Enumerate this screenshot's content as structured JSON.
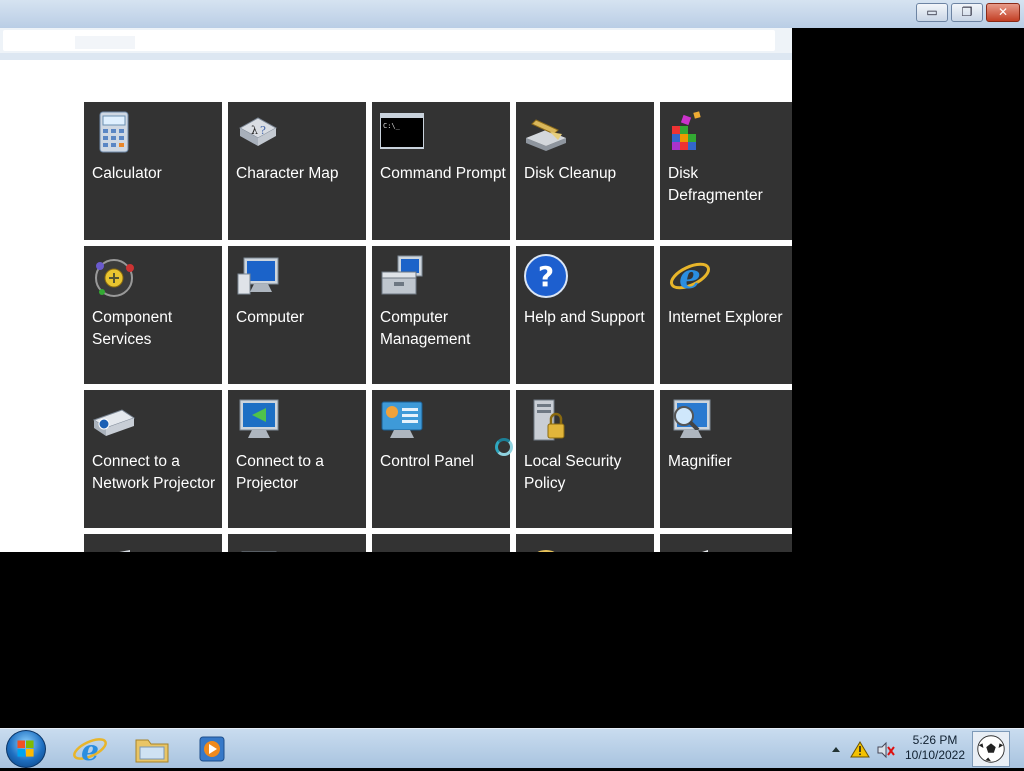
{
  "window": {
    "min_symbol": "▭",
    "max_symbol": "❐",
    "close_symbol": "✕"
  },
  "tiles": [
    {
      "label": "Calculator",
      "icon": "calculator-icon"
    },
    {
      "label": "Character Map",
      "icon": "character-map-icon"
    },
    {
      "label": "Command Prompt",
      "icon": "command-prompt-icon"
    },
    {
      "label": "Disk Cleanup",
      "icon": "disk-cleanup-icon"
    },
    {
      "label": "Disk Defragmenter",
      "icon": "disk-defragmenter-icon"
    },
    {
      "label": "Component Services",
      "icon": "component-services-icon"
    },
    {
      "label": "Computer",
      "icon": "computer-icon"
    },
    {
      "label": "Computer Management",
      "icon": "computer-management-icon"
    },
    {
      "label": "Help and Support",
      "icon": "help-icon"
    },
    {
      "label": "Internet Explorer",
      "icon": "internet-explorer-icon"
    },
    {
      "label": "Connect to a Network Projector",
      "icon": "network-projector-icon"
    },
    {
      "label": "Connect to a Projector",
      "icon": "projector-icon"
    },
    {
      "label": "Control Panel",
      "icon": "control-panel-icon"
    },
    {
      "label": "Local Security Policy",
      "icon": "security-policy-icon"
    },
    {
      "label": "Magnifier",
      "icon": "magnifier-icon"
    }
  ],
  "taskbar": {
    "apps": [
      "internet-explorer-icon",
      "file-explorer-icon",
      "media-player-icon"
    ],
    "time": "5:26 PM",
    "date": "10/10/2022"
  },
  "colors": {
    "tile_bg": "#333333",
    "titlebar": "#c7d7ea",
    "taskbar": "#b5cde6"
  }
}
